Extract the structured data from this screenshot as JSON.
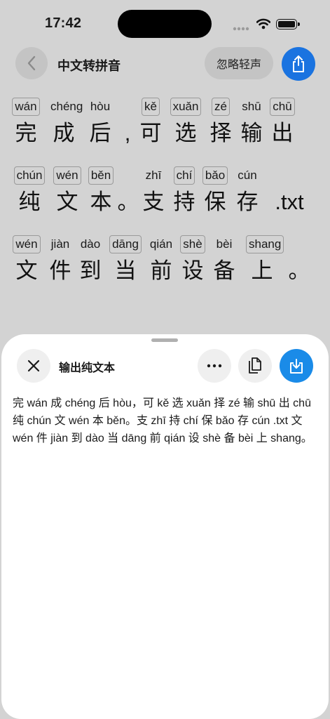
{
  "status_bar": {
    "time": "17:42"
  },
  "header": {
    "title": "中文转拼音",
    "ignore_tone_label": "忽略轻声",
    "back_icon": "chevron-left-icon",
    "share_icon": "share-icon"
  },
  "rows": [
    {
      "cells": [
        {
          "py": "wán",
          "hz": "完",
          "boxed": true
        },
        {
          "py": "chéng",
          "hz": "成",
          "boxed": false
        },
        {
          "py": "hòu",
          "hz": "后",
          "boxed": false
        },
        {
          "py": "",
          "hz": ",",
          "boxed": false
        },
        {
          "py": "kě",
          "hz": "可",
          "boxed": true
        },
        {
          "py": "xuǎn",
          "hz": "选",
          "boxed": true
        },
        {
          "py": "zé",
          "hz": "择",
          "boxed": true
        },
        {
          "py": "shū",
          "hz": "输",
          "boxed": false
        },
        {
          "py": "chū",
          "hz": "出",
          "boxed": true
        }
      ]
    },
    {
      "cells": [
        {
          "py": "chún",
          "hz": "纯",
          "boxed": true
        },
        {
          "py": "wén",
          "hz": "文",
          "boxed": true
        },
        {
          "py": "běn",
          "hz": "本",
          "boxed": true
        },
        {
          "py": "",
          "hz": "。",
          "boxed": false
        },
        {
          "py": "zhī",
          "hz": "支",
          "boxed": false
        },
        {
          "py": "chí",
          "hz": "持",
          "boxed": true
        },
        {
          "py": "bǎo",
          "hz": "保",
          "boxed": true
        },
        {
          "py": "cún",
          "hz": "存",
          "boxed": false
        },
        {
          "py": "",
          "hz": ".txt",
          "boxed": false
        }
      ]
    },
    {
      "cells": [
        {
          "py": "wén",
          "hz": "文",
          "boxed": true
        },
        {
          "py": "jiàn",
          "hz": "件",
          "boxed": false
        },
        {
          "py": "dào",
          "hz": "到",
          "boxed": false
        },
        {
          "py": "dāng",
          "hz": "当",
          "boxed": true
        },
        {
          "py": "qián",
          "hz": "前",
          "boxed": false
        },
        {
          "py": "shè",
          "hz": "设",
          "boxed": true
        },
        {
          "py": "bèi",
          "hz": "备",
          "boxed": false
        },
        {
          "py": "shang",
          "hz": "上",
          "boxed": true
        },
        {
          "py": "",
          "hz": "。",
          "boxed": false
        }
      ]
    }
  ],
  "sheet": {
    "title": "输出纯文本",
    "close_icon": "close-icon",
    "more_icon": "more-icon",
    "copy_icon": "copy-icon",
    "download_icon": "download-icon",
    "output_text": "完 wán 成 chéng 后 hòu，可 kě 选 xuǎn 择 zé 输 shū 出 chū 纯 chún 文 wén 本 běn。支 zhī 持 chí 保 bǎo 存 cún .txt 文 wén 件 jiàn 到 dào 当 dāng 前 qián 设 shè 备 bèi 上 shang。"
  },
  "colors": {
    "accent": "#1a73e0",
    "download_accent": "#1a8be8",
    "dim_background": "#d3d3d3"
  }
}
